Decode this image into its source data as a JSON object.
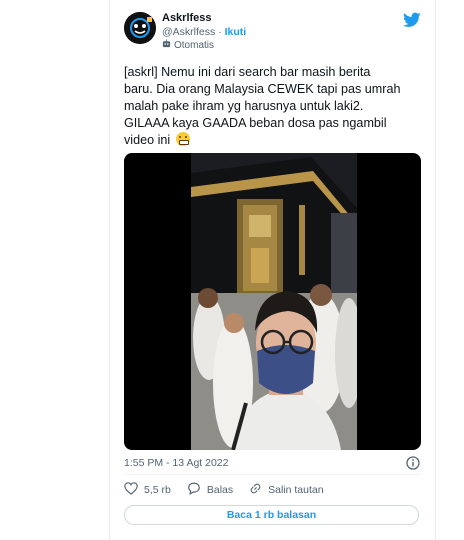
{
  "account": {
    "name": "Askrlfess",
    "handle": "@Askrlfess",
    "separator": " · ",
    "follow_label": "Ikuti",
    "automated_label": "Otomatis"
  },
  "tweet": {
    "text": "[askrl] Nemu ini dari search bar masih berita\nbaru. Dia orang Malaysia CEWEK tapi pas umrah\nmalah pake ihram yg harusnya untuk laki2.\nGILAAA kaya GAADA beban dosa pas ngambil\nvideo ini",
    "timestamp": "1:55 PM - 13 Agt 2022"
  },
  "actions": {
    "likes": "5,5 rb",
    "reply_label": "Balas",
    "copy_link_label": "Salin tautan"
  },
  "read_replies_label": "Baca 1 rb balasan",
  "icons": [
    "twitter-bird-icon",
    "robot-icon",
    "heart-icon",
    "reply-icon",
    "link-icon",
    "info-icon"
  ],
  "colors": {
    "brand": "#1d9bf0",
    "muted": "#536471"
  }
}
